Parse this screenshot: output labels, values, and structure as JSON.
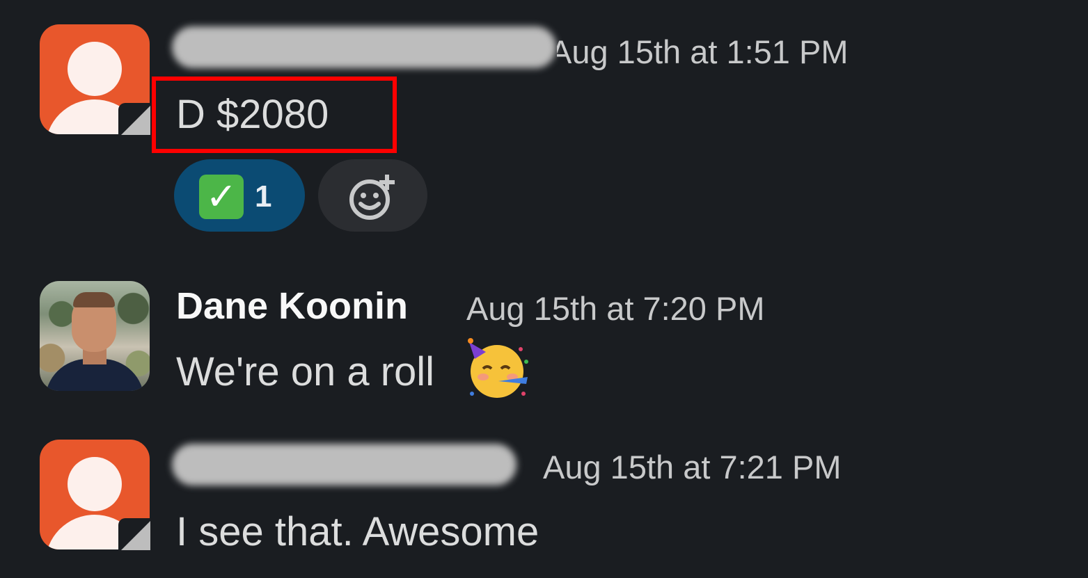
{
  "messages": [
    {
      "author": "",
      "author_redacted": true,
      "timestamp": "Aug 15th at 1:51 PM",
      "text": "D $2080",
      "avatar_icon": "default-user-icon",
      "reactions": [
        {
          "emoji": "white-check-mark",
          "glyph": "✓",
          "count": "1"
        }
      ]
    },
    {
      "author": "Dane Koonin",
      "timestamp": "Aug 15th at 7:20 PM",
      "text": "We're on a roll",
      "avatar_icon": "profile-photo",
      "emoji": "partying-face"
    },
    {
      "author": "",
      "author_redacted": true,
      "timestamp": "Aug 15th at 7:21 PM",
      "text": "I see that. Awesome",
      "avatar_icon": "default-user-icon"
    }
  ],
  "colors": {
    "background": "#1a1d21",
    "avatar_default": "#e8572c",
    "reaction_active": "#0b4b73",
    "highlight": "#ff0000"
  }
}
